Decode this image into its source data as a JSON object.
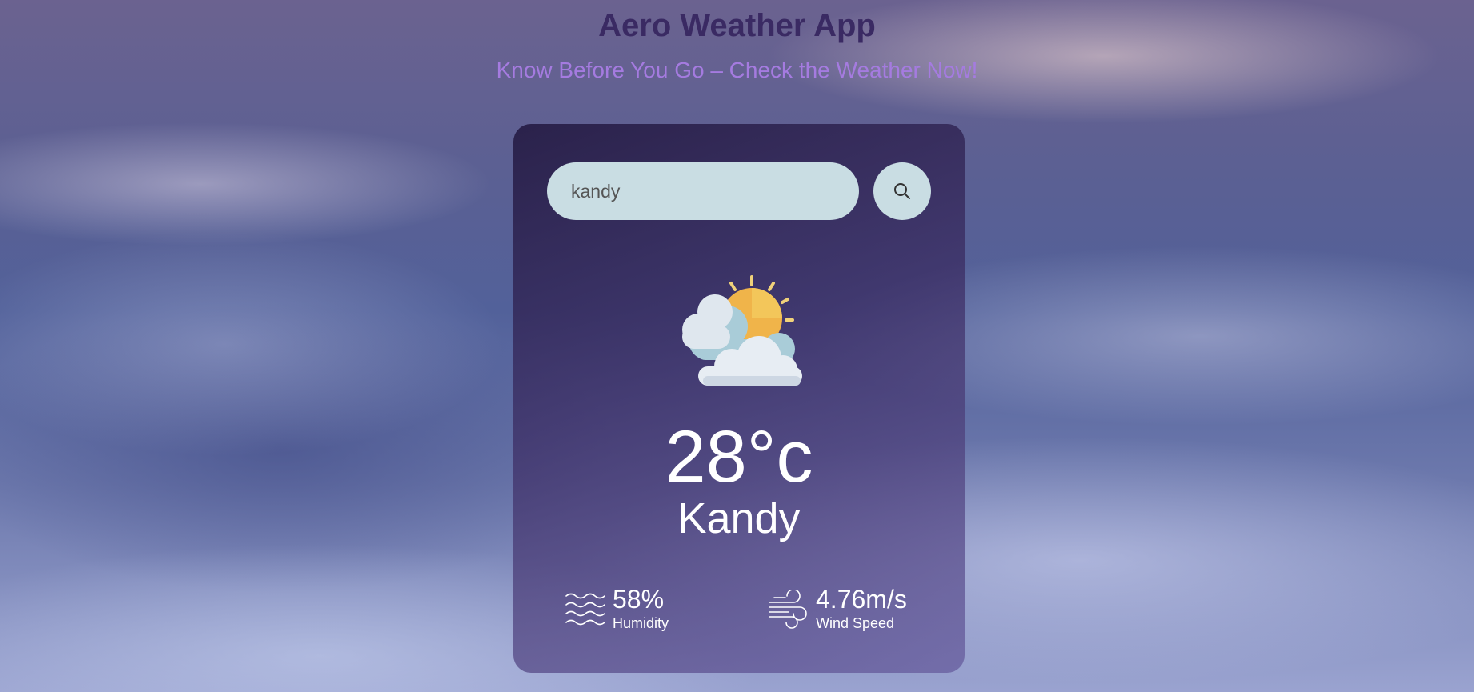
{
  "header": {
    "title": "Aero Weather App",
    "subtitle": "Know Before You Go – Check the Weather Now!"
  },
  "search": {
    "value": "kandy",
    "button_icon": "search-icon"
  },
  "weather": {
    "icon": "partly-cloudy-icon",
    "temperature": "28°c",
    "city": "Kandy"
  },
  "details": {
    "humidity": {
      "value": "58%",
      "label": "Humidity",
      "icon": "humidity-icon"
    },
    "wind": {
      "value": "4.76m/s",
      "label": "Wind Speed",
      "icon": "wind-icon"
    }
  },
  "colors": {
    "title": "#3a2a63",
    "subtitle": "#a57be0",
    "input_bg": "#c9dde3",
    "text_light": "#ffffff"
  }
}
